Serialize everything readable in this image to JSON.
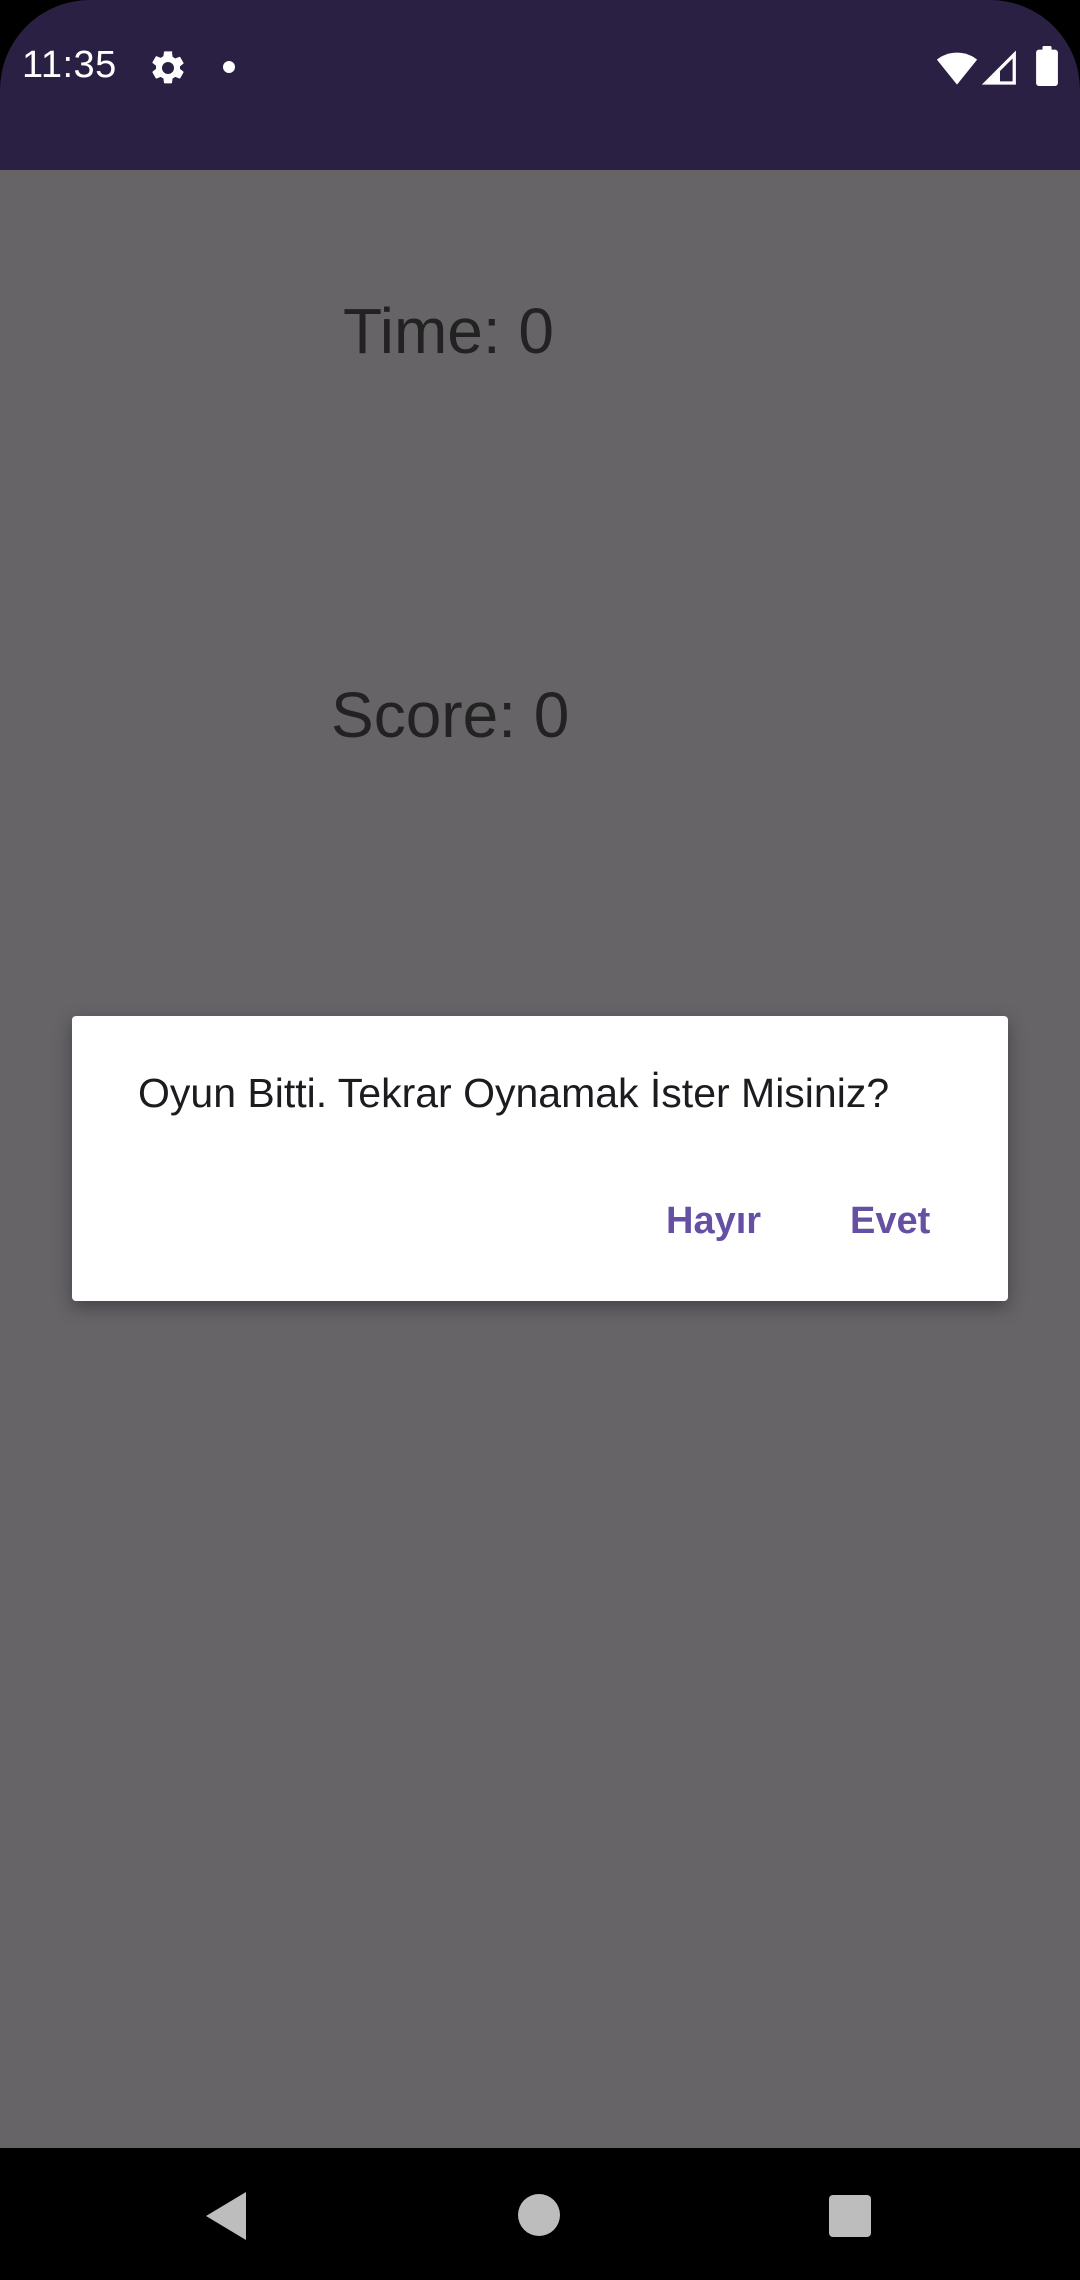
{
  "status_bar": {
    "time": "11:35",
    "icons": [
      "gear-icon",
      "dot-icon",
      "wifi-icon",
      "signal-icon",
      "battery-icon"
    ]
  },
  "game": {
    "time_label": "Time: 0",
    "score_label": "Score: 0"
  },
  "dialog": {
    "message": "Oyun Bitti. Tekrar Oynamak İster Misiniz?",
    "negative_button": "Hayır",
    "positive_button": "Evet"
  },
  "nav_bar": {
    "icons": [
      "back-icon",
      "home-icon",
      "recents-icon"
    ]
  },
  "colors": {
    "status_bar": "#2a2043",
    "scrim_background": "#666467",
    "dialog_button": "#6650a4",
    "dialog_background": "#ffffff"
  }
}
